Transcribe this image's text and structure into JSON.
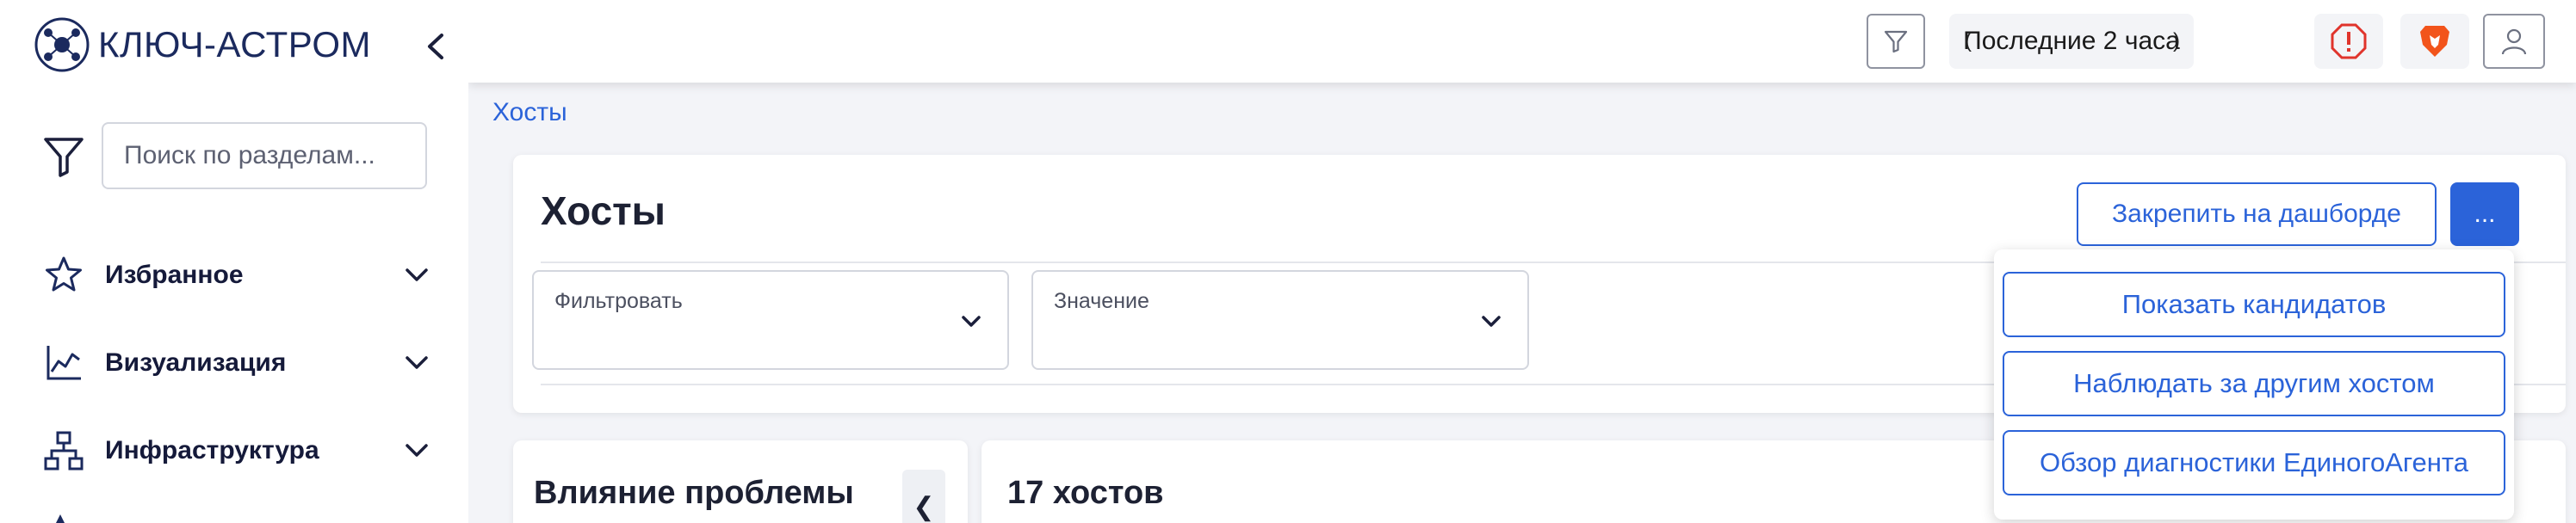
{
  "brand": {
    "name": "КЛЮЧ-АСТРОМ"
  },
  "sidebar": {
    "search_placeholder": "Поиск по разделам...",
    "items": [
      {
        "label": "Избранное",
        "icon": "star-icon"
      },
      {
        "label": "Визуализация",
        "icon": "line-chart-icon"
      },
      {
        "label": "Инфраструктура",
        "icon": "hierarchy-icon"
      }
    ]
  },
  "topbar": {
    "time_range": {
      "label": "Последние 2 часа",
      "prev_symbol": "(",
      "next_symbol": ")"
    },
    "icons": [
      "filter-icon",
      "alert-icon",
      "brave-browser-icon",
      "user-icon"
    ]
  },
  "breadcrumb": {
    "label": "Хосты"
  },
  "page": {
    "title": "Хосты",
    "pin_button": "Закрепить на дашборде",
    "more_button": "...",
    "filters": [
      {
        "label": "Фильтровать"
      },
      {
        "label": "Значение"
      }
    ]
  },
  "menu": {
    "items": [
      {
        "label": "Показать кандидатов"
      },
      {
        "label": "Наблюдать за другим хостом"
      },
      {
        "label": "Обзор диагностики ЕдиногоАгента"
      }
    ]
  },
  "panels": {
    "impact_title": "Влияние проблемы",
    "collapse_symbol": "❮",
    "hosts_count": "17 хостов"
  },
  "colors": {
    "accent": "#2b63d9",
    "alert": "#e0342c",
    "brave": "#f2541b",
    "navy": "#1b2a5e"
  }
}
